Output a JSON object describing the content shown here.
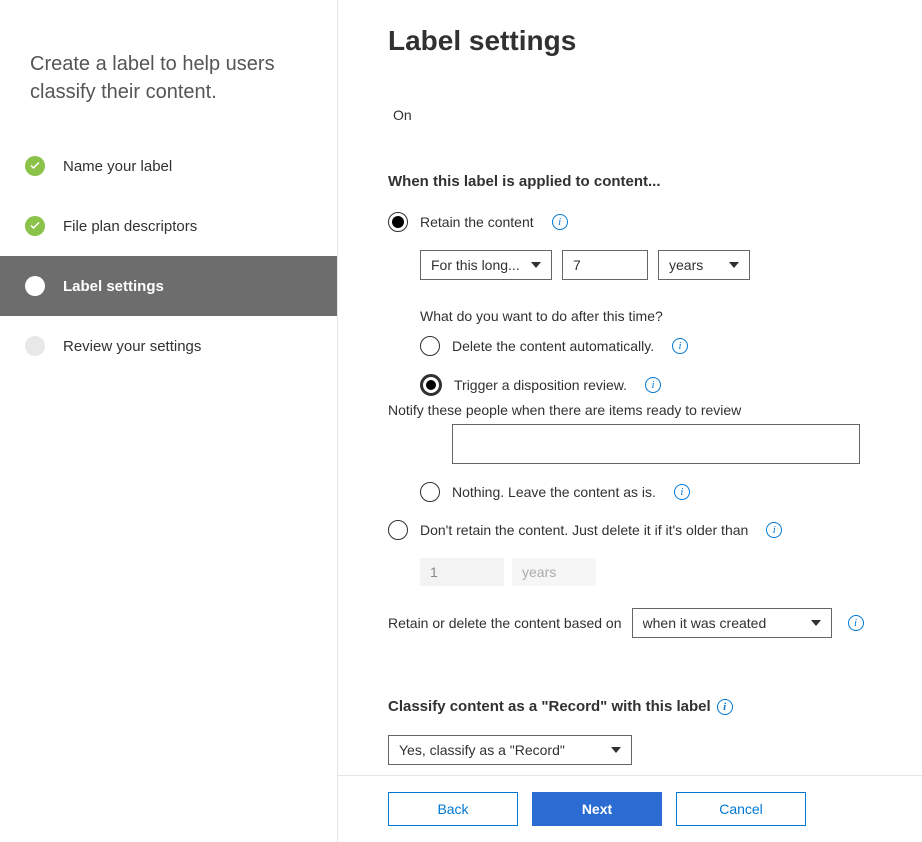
{
  "sidebar": {
    "header": "Create a label to help users classify their content.",
    "steps": [
      {
        "label": "Name your label",
        "state": "done"
      },
      {
        "label": "File plan descriptors",
        "state": "done"
      },
      {
        "label": "Label settings",
        "state": "current"
      },
      {
        "label": "Review your settings",
        "state": "pending"
      }
    ]
  },
  "page": {
    "title": "Label settings",
    "toggle_state": "On",
    "when_applied_title": "When this label is applied to content...",
    "retain_label": "Retain the content",
    "duration_mode": "For this long...",
    "duration_value": "7",
    "duration_unit": "years",
    "after_time_q": "What do you want to do after this time?",
    "opt_delete": "Delete the content automatically.",
    "opt_trigger": "Trigger a disposition review.",
    "notify_label": "Notify these people when there are items ready to review",
    "opt_nothing": "Nothing. Leave the content as is.",
    "opt_dont_retain": "Don't retain the content. Just delete it if it's older than",
    "disabled_value": "1",
    "disabled_unit": "years",
    "based_on_label": "Retain or delete the content based on",
    "based_on_value": "when it was created",
    "record_title": "Classify content as a \"Record\" with this label",
    "record_value": "Yes, classify as a \"Record\""
  },
  "footer": {
    "back": "Back",
    "next": "Next",
    "cancel": "Cancel"
  }
}
